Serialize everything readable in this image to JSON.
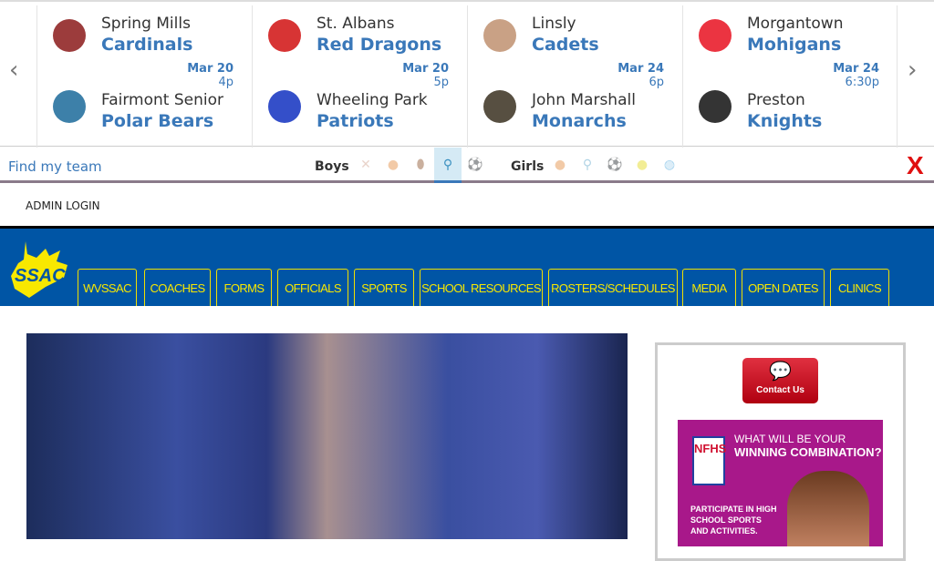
{
  "scoreboard": {
    "games": [
      {
        "home": {
          "city": "Spring Mills",
          "mascot": "Cardinals",
          "logo": "cardinal-logo",
          "color": "#8b1a1a"
        },
        "away": {
          "city": "Fairmont Senior",
          "mascot": "Polar Bears",
          "logo": "paw-logo",
          "color": "#1b6a9a"
        },
        "date": "Mar 20",
        "time": "4p"
      },
      {
        "home": {
          "city": "St. Albans",
          "mascot": "Red Dragons",
          "logo": "sa-logo",
          "color": "#d01010"
        },
        "away": {
          "city": "Wheeling Park",
          "mascot": "Patriots",
          "logo": "wp-logo",
          "color": "#1030c0"
        },
        "date": "Mar 20",
        "time": "5p"
      },
      {
        "home": {
          "city": "Linsly",
          "mascot": "Cadets",
          "logo": "linsly-logo",
          "color": "#c09070"
        },
        "away": {
          "city": "John Marshall",
          "mascot": "Monarchs",
          "logo": "lion-logo",
          "color": "#3a3020"
        },
        "date": "Mar 24",
        "time": "6p"
      },
      {
        "home": {
          "city": "Morgantown",
          "mascot": "Mohigans",
          "logo": "m-logo",
          "color": "#e81020"
        },
        "away": {
          "city": "Preston",
          "mascot": "Knights",
          "logo": "p-shield-logo",
          "color": "#111111"
        },
        "date": "Mar 24",
        "time": "6:30p"
      }
    ]
  },
  "filter": {
    "find_label": "Find my team",
    "boys_label": "Boys",
    "girls_label": "Girls",
    "boys_sports": [
      {
        "icon": "baseball-bat-icon",
        "color": "#d8b0a0"
      },
      {
        "icon": "basketball-icon",
        "color": "#e8a060"
      },
      {
        "icon": "football-icon",
        "color": "#a07050"
      },
      {
        "icon": "lacrosse-icon",
        "color": "#3a90c0",
        "selected": true
      },
      {
        "icon": "soccer-icon",
        "color": "#999999"
      }
    ],
    "girls_sports": [
      {
        "icon": "basketball-icon",
        "color": "#e8a060"
      },
      {
        "icon": "lacrosse-icon",
        "color": "#70b0d0"
      },
      {
        "icon": "soccer-icon",
        "color": "#999999"
      },
      {
        "icon": "softball-icon",
        "color": "#e8e040"
      },
      {
        "icon": "volleyball-icon",
        "color": "#60b0e0"
      }
    ],
    "close_color": "#e01010"
  },
  "admin_login": "ADMIN LOGIN",
  "nav": {
    "logo_text": "SSAC",
    "tabs": [
      "WVSSAC",
      "COACHES",
      "FORMS",
      "OFFICIALS",
      "SPORTS",
      "SCHOOL RESOURCES",
      "ROSTERS/SCHEDULES",
      "MEDIA",
      "OPEN DATES",
      "CLINICS"
    ],
    "bg": "#0055a5",
    "accent": "#f8e800"
  },
  "sidebar": {
    "contact_label": "Contact Us",
    "ad": {
      "logo": "NFHS",
      "headline1": "WHAT WILL BE YOUR",
      "headline2": "WINNING COMBINATION?",
      "body": "PARTICIPATE IN HIGH SCHOOL SPORTS AND ACTIVITIES."
    }
  }
}
